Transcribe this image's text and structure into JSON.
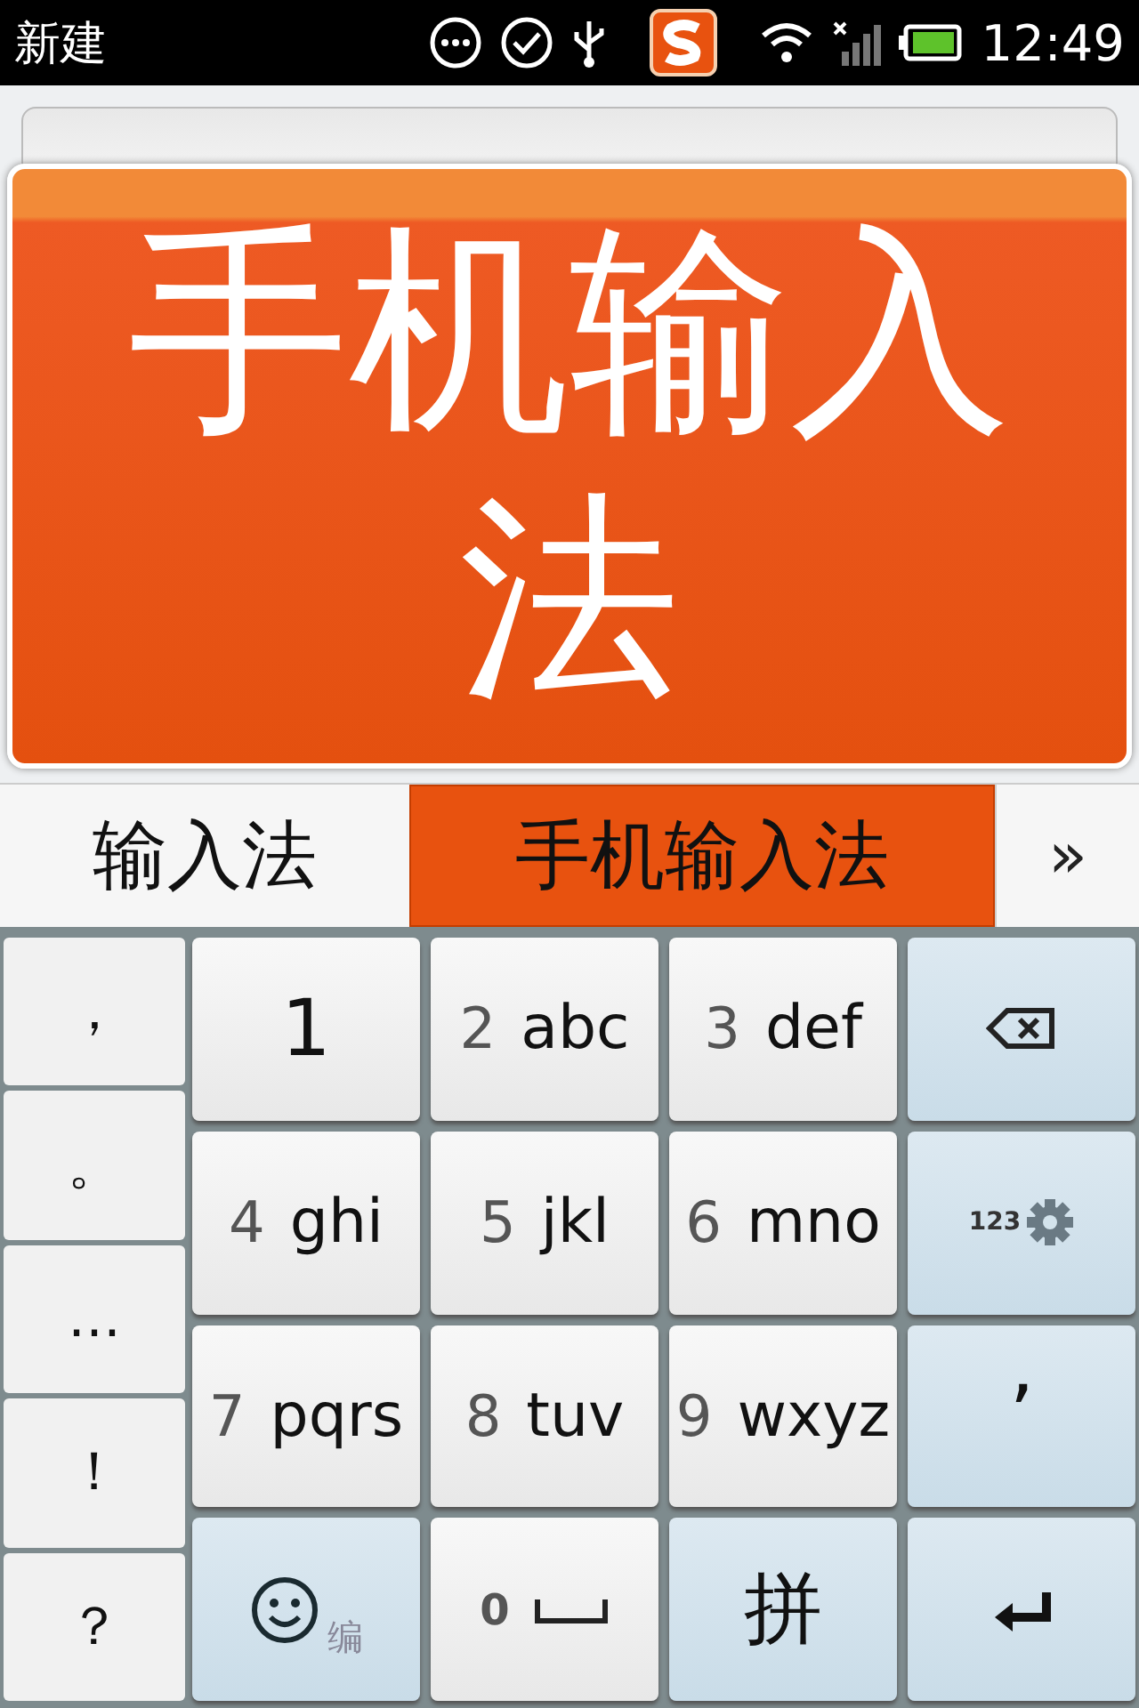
{
  "status_bar": {
    "title": "新建",
    "time": "12:49"
  },
  "popup": {
    "text": "手机输入法"
  },
  "candidates": [
    {
      "text": "输入法",
      "selected": false
    },
    {
      "text": "手机输入法",
      "selected": true
    }
  ],
  "more": "»",
  "punctuation": [
    "，",
    "。",
    "…",
    "！",
    "？"
  ],
  "keys": [
    {
      "kind": "digit",
      "digit": "1"
    },
    {
      "kind": "t9",
      "digit": "2",
      "letters": "abc"
    },
    {
      "kind": "t9",
      "digit": "3",
      "letters": "def"
    },
    {
      "kind": "backspace"
    },
    {
      "kind": "t9",
      "digit": "4",
      "letters": "ghi"
    },
    {
      "kind": "t9",
      "digit": "5",
      "letters": "jkl"
    },
    {
      "kind": "t9",
      "digit": "6",
      "letters": "mno"
    },
    {
      "kind": "settings",
      "label": "123"
    },
    {
      "kind": "t9",
      "digit": "7",
      "letters": "pqrs"
    },
    {
      "kind": "t9",
      "digit": "8",
      "letters": "tuv"
    },
    {
      "kind": "t9",
      "digit": "9",
      "letters": "wxyz"
    },
    {
      "kind": "char",
      "label": "’"
    },
    {
      "kind": "emoji",
      "label": "编"
    },
    {
      "kind": "space",
      "digit": "0"
    },
    {
      "kind": "char",
      "label": "拼"
    },
    {
      "kind": "enter"
    }
  ]
}
